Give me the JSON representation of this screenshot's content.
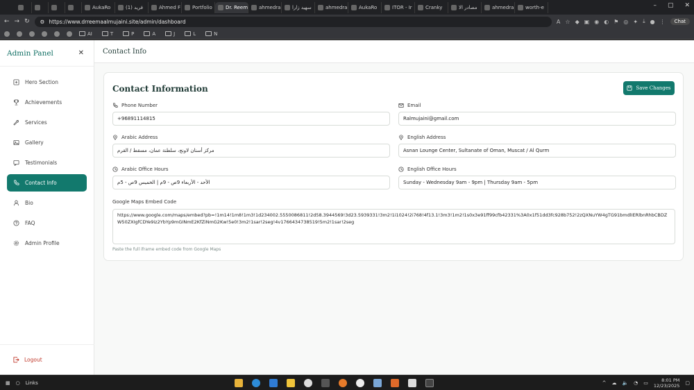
{
  "browser": {
    "tabs": [
      {
        "label": "",
        "active": false
      },
      {
        "label": "",
        "active": false
      },
      {
        "label": "",
        "active": false
      },
      {
        "label": "",
        "active": false
      },
      {
        "label": "AukaRo",
        "active": false
      },
      {
        "label": "(1) فرید",
        "active": false
      },
      {
        "label": "Ahmed F",
        "active": false
      },
      {
        "label": "Portfolio",
        "active": false
      },
      {
        "label": "Dr. Reem",
        "active": true
      },
      {
        "label": "ahmedra",
        "active": false
      },
      {
        "label": "سهيد زارا",
        "active": false
      },
      {
        "label": "ahmedra",
        "active": false
      },
      {
        "label": "AukaRo",
        "active": false
      },
      {
        "label": "ITOR - Ir",
        "active": false
      },
      {
        "label": "Cranky",
        "active": false
      },
      {
        "label": "مصادر الا",
        "active": false
      },
      {
        "label": "ahmedra",
        "active": false
      },
      {
        "label": "worth-e",
        "active": false
      }
    ],
    "url": "https://www.drreemaalmujaini.site/admin/dashboard",
    "chat_label": "Chat",
    "bookmarks": [
      "AI",
      "T",
      "P",
      "A",
      "J",
      "L",
      "N"
    ]
  },
  "sidebar": {
    "title": "Admin Panel",
    "items": [
      {
        "label": "Hero Section",
        "icon": "sparkle-icon",
        "active": false
      },
      {
        "label": "Achievements",
        "icon": "trophy-icon",
        "active": false
      },
      {
        "label": "Services",
        "icon": "wrench-icon",
        "active": false
      },
      {
        "label": "Gallery",
        "icon": "image-icon",
        "active": false
      },
      {
        "label": "Testimonials",
        "icon": "message-icon",
        "active": false
      },
      {
        "label": "Contact Info",
        "icon": "phone-icon",
        "active": true
      },
      {
        "label": "Bio",
        "icon": "user-icon",
        "active": false
      },
      {
        "label": "FAQ",
        "icon": "help-icon",
        "active": false
      },
      {
        "label": "Admin Profile",
        "icon": "gear-icon",
        "active": false
      }
    ],
    "logout_label": "Logout"
  },
  "header": {
    "title": "Contact Info"
  },
  "form": {
    "title": "Contact Information",
    "save_label": "Save Changes",
    "phone": {
      "label": "Phone Number",
      "value": "+96891114815"
    },
    "email": {
      "label": "Email",
      "value": "Ralmujaini@gmail.com"
    },
    "arabic_address": {
      "label": "Arabic Address",
      "value": "مركز أسنان لاونج، سلطنة عمان، مسقط / القرم"
    },
    "english_address": {
      "label": "English Address",
      "value": "Asnan Lounge Center, Sultanate of Oman, Muscat / Al Qurm"
    },
    "arabic_hours": {
      "label": "Arabic Office Hours",
      "value": "الأحد - الأربعاء 9ص - 9م | الخميس 9ص - 5م"
    },
    "english_hours": {
      "label": "English Office Hours",
      "value": "Sunday - Wednesday 9am - 9pm | Thursday 9am - 5pm"
    },
    "maps": {
      "label": "Google Maps Embed Code",
      "value": "https://www.google.com/maps/embed?pb=!1m14!1m8!1m3!1d234002.5550086811!2d58.3944569!3d23.5939331!3m2!1i1024!2i768!4f13.1!3m3!1m2!1s0x3e91ff99cfb42331%3A0x1f51dd3fc928b752!2zQXNuYW4gTG91bmdlIERlbnRhbCBDZW50ZXIgfCDYe9iz2YbYp9mGINmE2KfZiNmG2Kw!5e0!3m2!1sar!2seg!4v1766434738519!5m2!1sar!2seg",
      "hint": "Paste the full iframe embed code from Google Maps"
    }
  },
  "taskbar": {
    "search_label": "Links",
    "time": "8:01 PM",
    "date": "12/23/2025"
  }
}
